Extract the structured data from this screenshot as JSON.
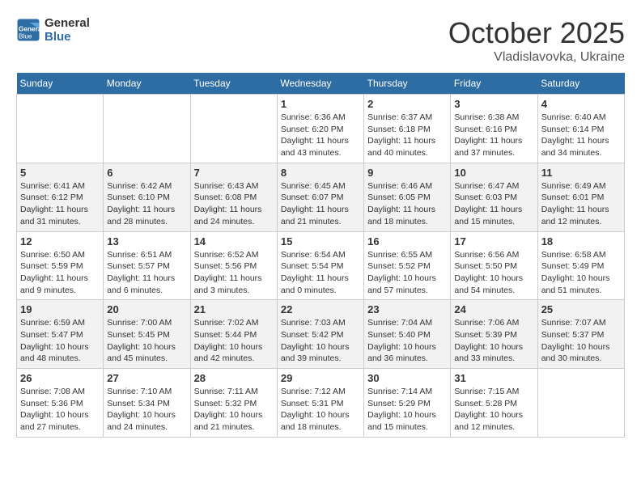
{
  "header": {
    "logo_line1": "General",
    "logo_line2": "Blue",
    "month": "October 2025",
    "location": "Vladislavovka, Ukraine"
  },
  "days_of_week": [
    "Sunday",
    "Monday",
    "Tuesday",
    "Wednesday",
    "Thursday",
    "Friday",
    "Saturday"
  ],
  "weeks": [
    [
      {
        "num": "",
        "sunrise": "",
        "sunset": "",
        "daylight": ""
      },
      {
        "num": "",
        "sunrise": "",
        "sunset": "",
        "daylight": ""
      },
      {
        "num": "",
        "sunrise": "",
        "sunset": "",
        "daylight": ""
      },
      {
        "num": "1",
        "sunrise": "Sunrise: 6:36 AM",
        "sunset": "Sunset: 6:20 PM",
        "daylight": "Daylight: 11 hours and 43 minutes."
      },
      {
        "num": "2",
        "sunrise": "Sunrise: 6:37 AM",
        "sunset": "Sunset: 6:18 PM",
        "daylight": "Daylight: 11 hours and 40 minutes."
      },
      {
        "num": "3",
        "sunrise": "Sunrise: 6:38 AM",
        "sunset": "Sunset: 6:16 PM",
        "daylight": "Daylight: 11 hours and 37 minutes."
      },
      {
        "num": "4",
        "sunrise": "Sunrise: 6:40 AM",
        "sunset": "Sunset: 6:14 PM",
        "daylight": "Daylight: 11 hours and 34 minutes."
      }
    ],
    [
      {
        "num": "5",
        "sunrise": "Sunrise: 6:41 AM",
        "sunset": "Sunset: 6:12 PM",
        "daylight": "Daylight: 11 hours and 31 minutes."
      },
      {
        "num": "6",
        "sunrise": "Sunrise: 6:42 AM",
        "sunset": "Sunset: 6:10 PM",
        "daylight": "Daylight: 11 hours and 28 minutes."
      },
      {
        "num": "7",
        "sunrise": "Sunrise: 6:43 AM",
        "sunset": "Sunset: 6:08 PM",
        "daylight": "Daylight: 11 hours and 24 minutes."
      },
      {
        "num": "8",
        "sunrise": "Sunrise: 6:45 AM",
        "sunset": "Sunset: 6:07 PM",
        "daylight": "Daylight: 11 hours and 21 minutes."
      },
      {
        "num": "9",
        "sunrise": "Sunrise: 6:46 AM",
        "sunset": "Sunset: 6:05 PM",
        "daylight": "Daylight: 11 hours and 18 minutes."
      },
      {
        "num": "10",
        "sunrise": "Sunrise: 6:47 AM",
        "sunset": "Sunset: 6:03 PM",
        "daylight": "Daylight: 11 hours and 15 minutes."
      },
      {
        "num": "11",
        "sunrise": "Sunrise: 6:49 AM",
        "sunset": "Sunset: 6:01 PM",
        "daylight": "Daylight: 11 hours and 12 minutes."
      }
    ],
    [
      {
        "num": "12",
        "sunrise": "Sunrise: 6:50 AM",
        "sunset": "Sunset: 5:59 PM",
        "daylight": "Daylight: 11 hours and 9 minutes."
      },
      {
        "num": "13",
        "sunrise": "Sunrise: 6:51 AM",
        "sunset": "Sunset: 5:57 PM",
        "daylight": "Daylight: 11 hours and 6 minutes."
      },
      {
        "num": "14",
        "sunrise": "Sunrise: 6:52 AM",
        "sunset": "Sunset: 5:56 PM",
        "daylight": "Daylight: 11 hours and 3 minutes."
      },
      {
        "num": "15",
        "sunrise": "Sunrise: 6:54 AM",
        "sunset": "Sunset: 5:54 PM",
        "daylight": "Daylight: 11 hours and 0 minutes."
      },
      {
        "num": "16",
        "sunrise": "Sunrise: 6:55 AM",
        "sunset": "Sunset: 5:52 PM",
        "daylight": "Daylight: 10 hours and 57 minutes."
      },
      {
        "num": "17",
        "sunrise": "Sunrise: 6:56 AM",
        "sunset": "Sunset: 5:50 PM",
        "daylight": "Daylight: 10 hours and 54 minutes."
      },
      {
        "num": "18",
        "sunrise": "Sunrise: 6:58 AM",
        "sunset": "Sunset: 5:49 PM",
        "daylight": "Daylight: 10 hours and 51 minutes."
      }
    ],
    [
      {
        "num": "19",
        "sunrise": "Sunrise: 6:59 AM",
        "sunset": "Sunset: 5:47 PM",
        "daylight": "Daylight: 10 hours and 48 minutes."
      },
      {
        "num": "20",
        "sunrise": "Sunrise: 7:00 AM",
        "sunset": "Sunset: 5:45 PM",
        "daylight": "Daylight: 10 hours and 45 minutes."
      },
      {
        "num": "21",
        "sunrise": "Sunrise: 7:02 AM",
        "sunset": "Sunset: 5:44 PM",
        "daylight": "Daylight: 10 hours and 42 minutes."
      },
      {
        "num": "22",
        "sunrise": "Sunrise: 7:03 AM",
        "sunset": "Sunset: 5:42 PM",
        "daylight": "Daylight: 10 hours and 39 minutes."
      },
      {
        "num": "23",
        "sunrise": "Sunrise: 7:04 AM",
        "sunset": "Sunset: 5:40 PM",
        "daylight": "Daylight: 10 hours and 36 minutes."
      },
      {
        "num": "24",
        "sunrise": "Sunrise: 7:06 AM",
        "sunset": "Sunset: 5:39 PM",
        "daylight": "Daylight: 10 hours and 33 minutes."
      },
      {
        "num": "25",
        "sunrise": "Sunrise: 7:07 AM",
        "sunset": "Sunset: 5:37 PM",
        "daylight": "Daylight: 10 hours and 30 minutes."
      }
    ],
    [
      {
        "num": "26",
        "sunrise": "Sunrise: 7:08 AM",
        "sunset": "Sunset: 5:36 PM",
        "daylight": "Daylight: 10 hours and 27 minutes."
      },
      {
        "num": "27",
        "sunrise": "Sunrise: 7:10 AM",
        "sunset": "Sunset: 5:34 PM",
        "daylight": "Daylight: 10 hours and 24 minutes."
      },
      {
        "num": "28",
        "sunrise": "Sunrise: 7:11 AM",
        "sunset": "Sunset: 5:32 PM",
        "daylight": "Daylight: 10 hours and 21 minutes."
      },
      {
        "num": "29",
        "sunrise": "Sunrise: 7:12 AM",
        "sunset": "Sunset: 5:31 PM",
        "daylight": "Daylight: 10 hours and 18 minutes."
      },
      {
        "num": "30",
        "sunrise": "Sunrise: 7:14 AM",
        "sunset": "Sunset: 5:29 PM",
        "daylight": "Daylight: 10 hours and 15 minutes."
      },
      {
        "num": "31",
        "sunrise": "Sunrise: 7:15 AM",
        "sunset": "Sunset: 5:28 PM",
        "daylight": "Daylight: 10 hours and 12 minutes."
      },
      {
        "num": "",
        "sunrise": "",
        "sunset": "",
        "daylight": ""
      }
    ]
  ]
}
